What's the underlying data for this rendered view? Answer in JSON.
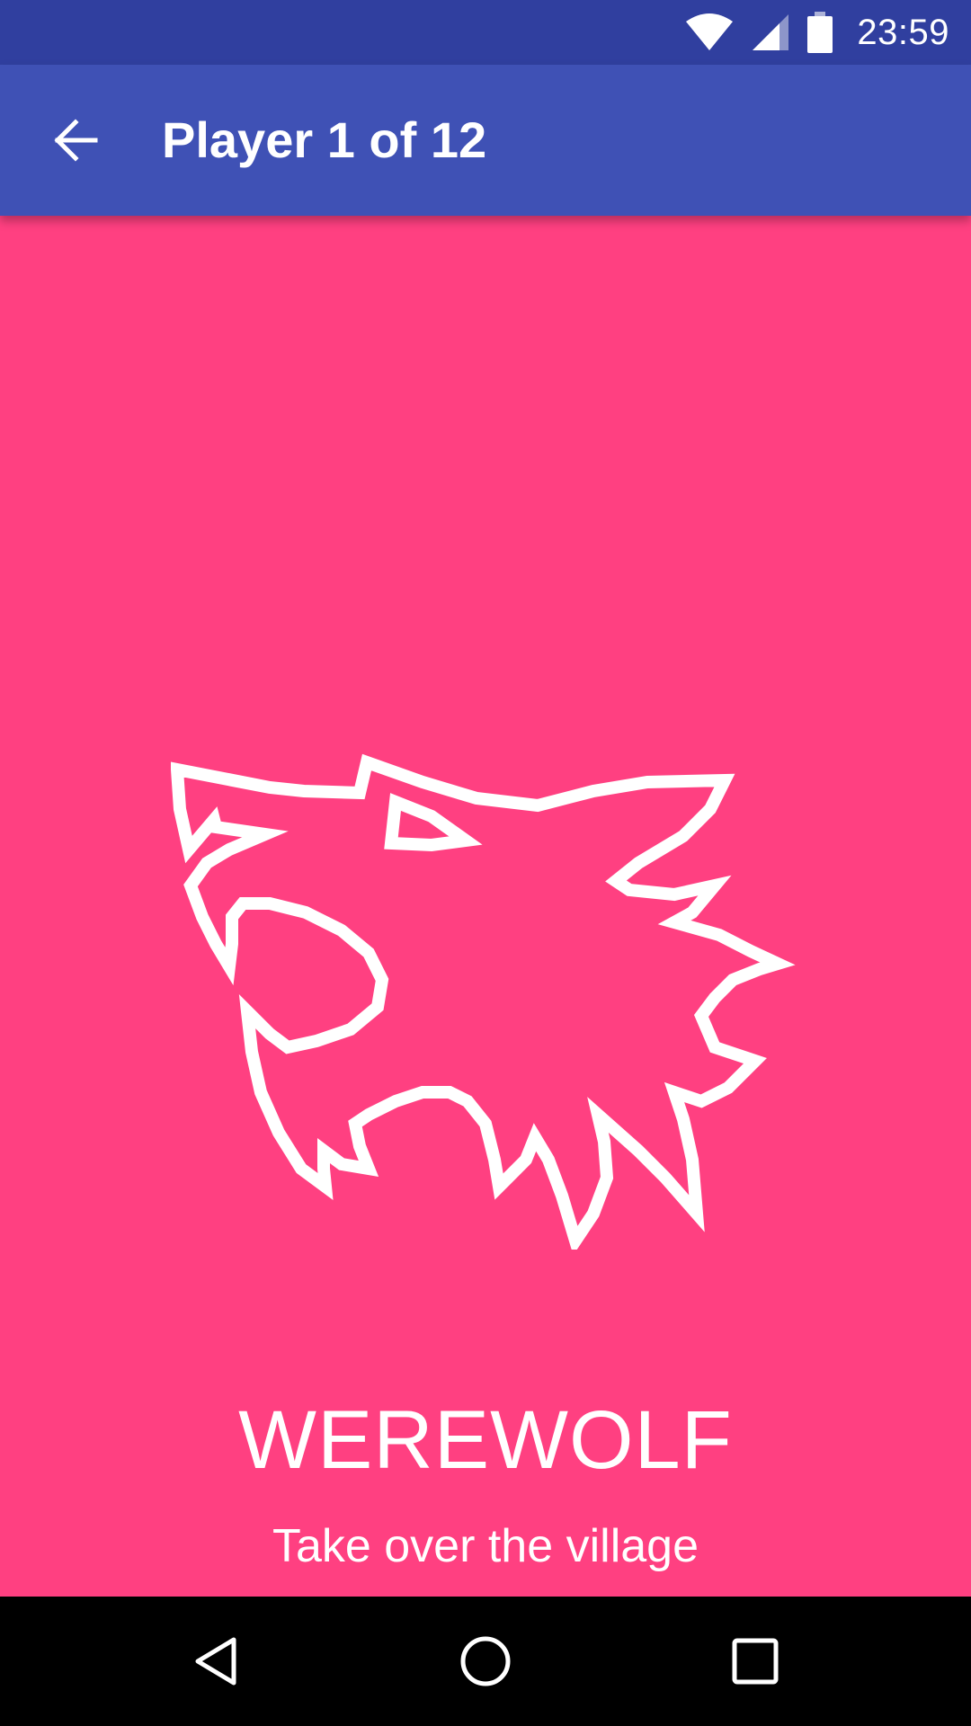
{
  "status_bar": {
    "time": "23:59",
    "icons": [
      "wifi-icon",
      "cell-signal-icon",
      "battery-icon"
    ]
  },
  "app_bar": {
    "title": "Player 1 of 12",
    "back_icon": "arrow-back-icon"
  },
  "role": {
    "icon": "werewolf-icon",
    "name": "WEREWOLF",
    "description": "Take over the village"
  },
  "nav_bar": {
    "buttons": [
      "back-triangle-icon",
      "home-circle-icon",
      "recents-square-icon"
    ]
  },
  "colors": {
    "status_bar": "#303f9f",
    "app_bar": "#3f51b5",
    "background": "#ff4081",
    "nav_bar": "#000000",
    "foreground": "#ffffff"
  }
}
